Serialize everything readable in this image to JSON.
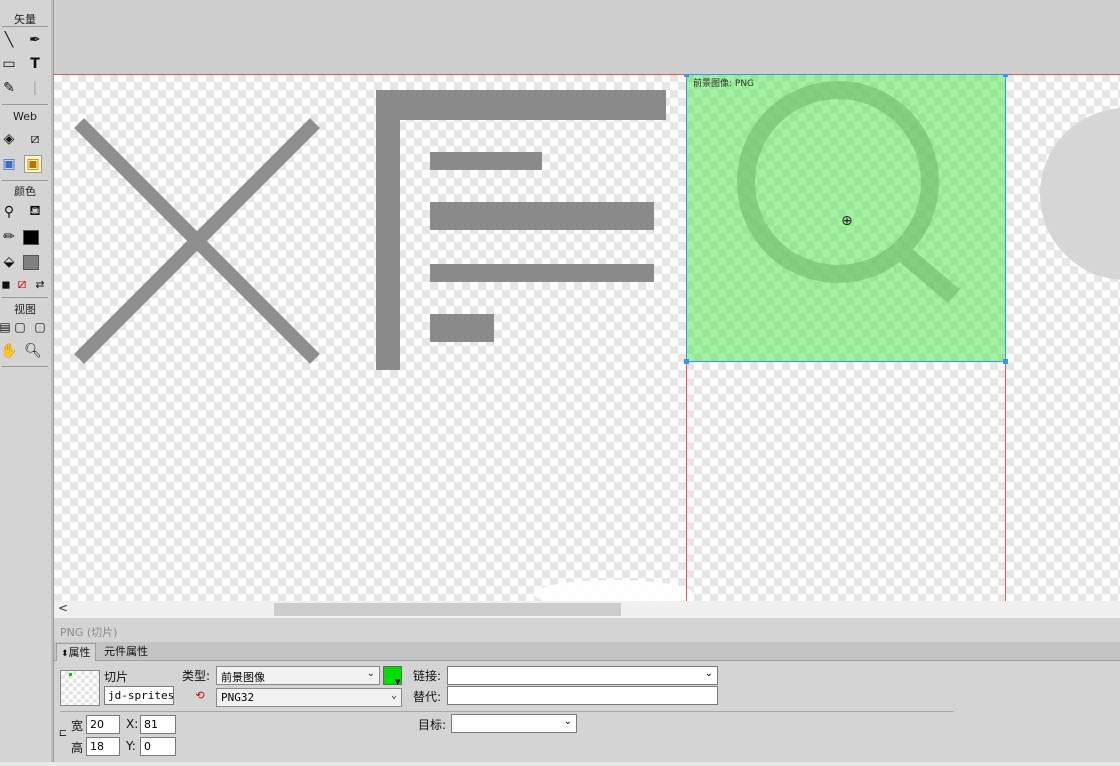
{
  "toolbar": {
    "vector_label": "矢量",
    "web_label": "Web",
    "color_label": "颜色",
    "view_label": "视图",
    "stroke_color": "#000000",
    "fill_color": "#808080",
    "icons": [
      "line-tool-icon",
      "pen-tool-icon",
      "rectangle-tool-icon",
      "text-tool-icon",
      "freeform-tool-icon",
      "knife-tool-icon",
      "hotspot-tool-icon",
      "slice-tool-icon",
      "hide-slices-icon",
      "show-slices-icon",
      "eyedropper-icon",
      "paint-bucket-icon",
      "stroke-color-icon",
      "fill-color-icon",
      "default-colors-icon",
      "no-color-icon",
      "swap-colors-icon",
      "standard-screen-icon",
      "full-screen-menu-icon",
      "full-screen-icon",
      "hand-tool-icon",
      "zoom-tool-icon"
    ]
  },
  "canvas": {
    "slice_label": "前景图像: PNG",
    "checker_color": "#e6e6e6",
    "slice_color": "#46e646",
    "guide_color": "#e05555"
  },
  "scrollbar": {
    "left_arrow": "<"
  },
  "status": {
    "text": "PNG (切片)"
  },
  "properties": {
    "tabs": [
      "属性",
      "元件属性"
    ],
    "object_type": "切片",
    "object_name": "jd-sprites_",
    "type_label": "类型:",
    "type_value": "前景图像",
    "format_value": "PNG32",
    "link_label": "链接:",
    "link_value": "",
    "alt_label": "替代:",
    "alt_value": "",
    "target_label": "目标:",
    "target_value": "",
    "width_label": "宽",
    "width_value": "20",
    "height_label": "高",
    "height_value": "18",
    "x_label": "X:",
    "x_value": "81",
    "y_label": "Y:",
    "y_value": "0",
    "slice_swatch_color": "#00e000"
  }
}
